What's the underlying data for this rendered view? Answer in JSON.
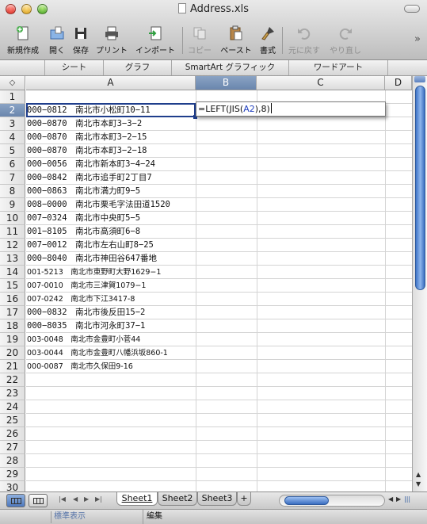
{
  "window": {
    "title": "Address.xls"
  },
  "toolbar": {
    "items": [
      {
        "label": "新規作成",
        "icon": "new-document-icon",
        "enabled": true
      },
      {
        "label": "開く",
        "icon": "open-folder-icon",
        "enabled": true
      },
      {
        "label": "保存",
        "icon": "save-disk-icon",
        "enabled": true
      },
      {
        "label": "プリント",
        "icon": "printer-icon",
        "enabled": true
      },
      {
        "label": "インポート",
        "icon": "import-icon",
        "enabled": true
      },
      {
        "label": "コピー",
        "icon": "copy-icon",
        "enabled": false
      },
      {
        "label": "ペースト",
        "icon": "paste-icon",
        "enabled": true
      },
      {
        "label": "書式",
        "icon": "format-brush-icon",
        "enabled": true
      },
      {
        "label": "元に戻す",
        "icon": "undo-icon",
        "enabled": false
      },
      {
        "label": "やり直し",
        "icon": "redo-icon",
        "enabled": false
      }
    ],
    "overflow": "»"
  },
  "ribbon_tabs": [
    "シート",
    "グラフ",
    "SmartArt グラフィック",
    "ワードアート"
  ],
  "corner_symbol": "◇",
  "columns": [
    "A",
    "B",
    "C",
    "D"
  ],
  "selected_column": "B",
  "rows": [
    "1",
    "2",
    "3",
    "4",
    "5",
    "6",
    "7",
    "8",
    "9",
    "10",
    "11",
    "12",
    "13",
    "14",
    "15",
    "16",
    "17",
    "18",
    "19",
    "20",
    "21",
    "22",
    "23",
    "24",
    "25",
    "26",
    "27",
    "28",
    "29",
    "30"
  ],
  "selected_row": "2",
  "cells_A": [
    "",
    "000−0812　南北市小松町10−11",
    "000−0870　南北市本町3−3−2",
    "000−0870　南北市本町3−2−15",
    "000−0870　南北市本町3−2−18",
    "000−0056　南北市新本町3−4−24",
    "000−0842　南北市追手町2丁目7",
    "000−0863　南北市満力町9−5",
    "008−0000　南北市栗毛字法田道1520",
    "007−0324　南北市中央町5−5",
    "001−8105　南北市高須町6−8",
    "007−0012　南北市左右山町8−25",
    "000−8040　南北市神田谷647番地",
    "001-5213　南北市東野町大野1629−1",
    "007-0010　南北市三津賀1079−1",
    "007-0242　南北市下江3417-8",
    "000−0832　南北市後反田15−2",
    "000−8035　南北市河永町37−1",
    "003-0048　南北市金豊町小菅44",
    "003-0044　南北市金豊町八幡浜坂860-1",
    "000-0087　南北市久保田9-16"
  ],
  "small_rows": [
    14,
    15,
    16,
    19,
    20,
    21
  ],
  "formula_editor": {
    "prefix": "=LEFT(JIS(",
    "ref": "A2",
    "suffix": "),8)"
  },
  "sheets": {
    "tabs": [
      "Sheet1",
      "Sheet2",
      "Sheet3"
    ],
    "add": "+",
    "active": "Sheet1"
  },
  "status": {
    "view_mode": "標準表示",
    "mode": "編集"
  },
  "colors": {
    "selection": "#1f3e8c",
    "header_selected": "#7592b9",
    "scroll_thumb": "#3f74c7"
  }
}
